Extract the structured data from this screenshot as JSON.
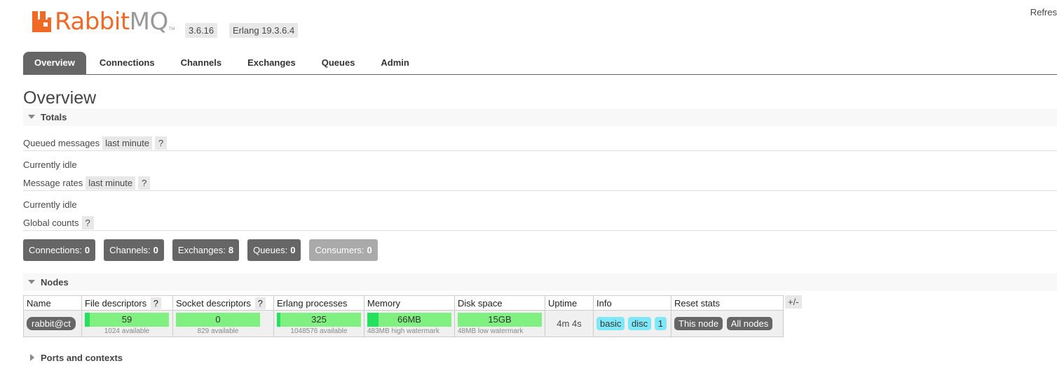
{
  "header": {
    "logo": {
      "brand_main": "Rabbit",
      "brand_suffix": "MQ",
      "trademark": "TM"
    },
    "version": "3.6.16",
    "erlang": "Erlang 19.3.6.4",
    "refresh": "Refres"
  },
  "tabs": [
    "Overview",
    "Connections",
    "Channels",
    "Exchanges",
    "Queues",
    "Admin"
  ],
  "active_tab": "Overview",
  "page_title": "Overview",
  "totals": {
    "section_label": "Totals",
    "queued_messages": {
      "label": "Queued messages",
      "range": "last minute",
      "help": "?",
      "status": "Currently idle"
    },
    "message_rates": {
      "label": "Message rates",
      "range": "last minute",
      "help": "?",
      "status": "Currently idle"
    },
    "global_counts": {
      "label": "Global counts",
      "help": "?"
    },
    "counts": [
      {
        "label": "Connections:",
        "value": "0"
      },
      {
        "label": "Channels:",
        "value": "0"
      },
      {
        "label": "Exchanges:",
        "value": "8"
      },
      {
        "label": "Queues:",
        "value": "0"
      },
      {
        "label": "Consumers:",
        "value": "0"
      }
    ]
  },
  "nodes": {
    "section_label": "Nodes",
    "columns": [
      "Name",
      "File descriptors",
      "Socket descriptors",
      "Erlang processes",
      "Memory",
      "Disk space",
      "Uptime",
      "Info",
      "Reset stats"
    ],
    "help": "?",
    "plus_minus": "+/-",
    "row": {
      "name": "rabbit@ct",
      "file_descriptors": {
        "value": "59",
        "sub": "1024 available",
        "fraction": 0.058
      },
      "socket_descriptors": {
        "value": "0",
        "sub": "829 available",
        "fraction": 0
      },
      "erlang_processes": {
        "value": "325",
        "sub": "1048576 available",
        "fraction": 0.0003
      },
      "memory": {
        "value": "66MB",
        "sub": "483MB high watermark",
        "fraction": 0.137
      },
      "disk_space": {
        "value": "15GB",
        "sub": "48MB low watermark",
        "fraction": 0
      },
      "uptime": "4m 4s",
      "info": [
        "basic",
        "disc",
        "1"
      ],
      "reset": [
        "This node",
        "All nodes"
      ]
    }
  },
  "ports": {
    "section_label": "Ports and contexts"
  },
  "colors": {
    "brand_orange": "#f06a26",
    "meter_green": "#80f080",
    "meter_fill": "#26e060",
    "info_tag": "#7fe8f8",
    "tab_active": "#666666"
  }
}
